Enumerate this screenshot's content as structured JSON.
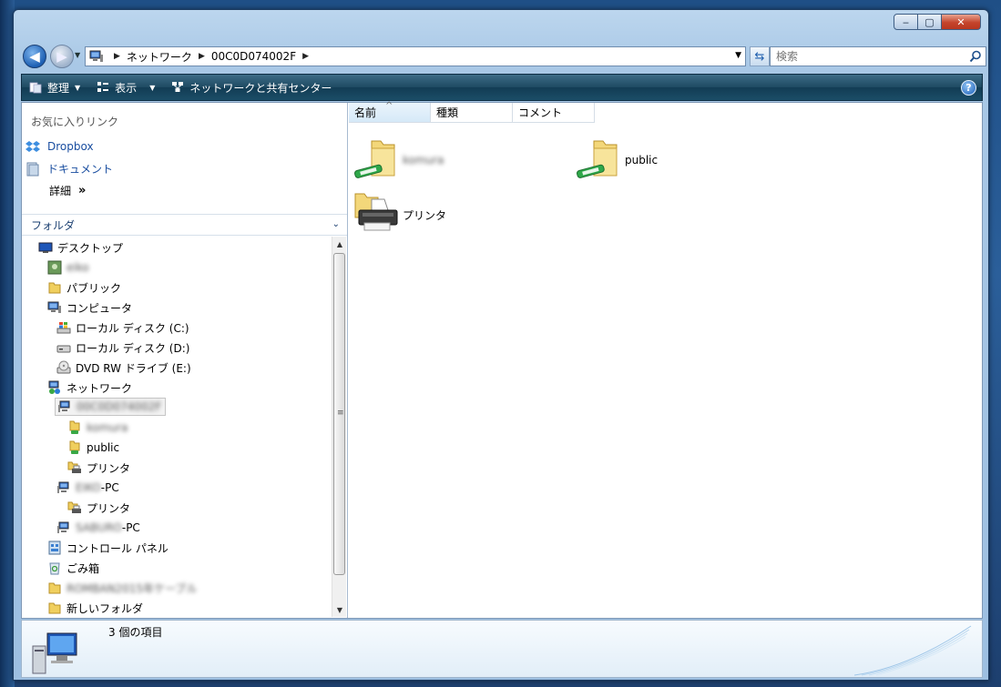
{
  "window": {
    "minimize_glyph": "‒",
    "maximize_glyph": "▢",
    "close_glyph": "✕"
  },
  "address": {
    "crumbs": [
      "ネットワーク",
      "00C0D074002F"
    ],
    "search_placeholder": "検索"
  },
  "toolbar": {
    "organize": "整理",
    "views": "表示",
    "network_center": "ネットワークと共有センター",
    "help": "?"
  },
  "favorites": {
    "header": "お気に入りリンク",
    "items": [
      "Dropbox",
      "ドキュメント"
    ],
    "more": "詳細"
  },
  "folders": {
    "header": "フォルダ",
    "tree": [
      {
        "label": "デスクトップ",
        "icon": "desktop-icon",
        "blurred": false
      },
      {
        "label": "eiko",
        "icon": "user-icon",
        "blurred": true
      },
      {
        "label": "パブリック",
        "icon": "folder-icon",
        "blurred": false
      },
      {
        "label": "コンピュータ",
        "icon": "computer-icon",
        "blurred": false
      },
      {
        "label": "ローカル ディスク (C:)",
        "icon": "windows-drive-icon",
        "blurred": false
      },
      {
        "label": "ローカル ディスク (D:)",
        "icon": "drive-icon",
        "blurred": false
      },
      {
        "label": "DVD RW ドライブ (E:)",
        "icon": "dvd-drive-icon",
        "blurred": false
      },
      {
        "label": "ネットワーク",
        "icon": "network-icon",
        "blurred": false
      },
      {
        "label": "00C0D074002F",
        "icon": "network-computer-icon",
        "blurred": true
      },
      {
        "label": "komura",
        "icon": "shared-folder-icon",
        "blurred": true
      },
      {
        "label": "public",
        "icon": "shared-folder-icon",
        "blurred": false
      },
      {
        "label": "プリンタ",
        "icon": "printer-folder-icon",
        "blurred": false
      },
      {
        "label_blur": "EIKO",
        "label": "-PC",
        "icon": "network-computer-icon",
        "blurred": false
      },
      {
        "label": "プリンタ",
        "icon": "printer-folder-icon",
        "blurred": false
      },
      {
        "label_blur": "SABURO",
        "label": "-PC",
        "icon": "network-computer-icon",
        "blurred": false
      },
      {
        "label": "コントロール パネル",
        "icon": "control-panel-icon",
        "blurred": false
      },
      {
        "label": "ごみ箱",
        "icon": "recycle-bin-icon",
        "blurred": false
      },
      {
        "label": "ROMBAN2015年ケーブル",
        "icon": "folder-icon",
        "blurred": true
      },
      {
        "label": "新しいフォルダ",
        "icon": "folder-icon",
        "blurred": false
      }
    ]
  },
  "columns": [
    "名前",
    "種類",
    "コメント"
  ],
  "files": [
    {
      "label": "komura",
      "icon": "shared-folder-icon",
      "blurred": true
    },
    {
      "label": "public",
      "icon": "shared-folder-icon",
      "blurred": false
    },
    {
      "label": "プリンタ",
      "icon": "printer-folder-icon",
      "blurred": false
    }
  ],
  "status": {
    "item_count": "3 個の項目"
  },
  "colors": {
    "toolbar": "#1e4a62",
    "link": "#1a4ea0",
    "frame": "#a9c8e6"
  }
}
